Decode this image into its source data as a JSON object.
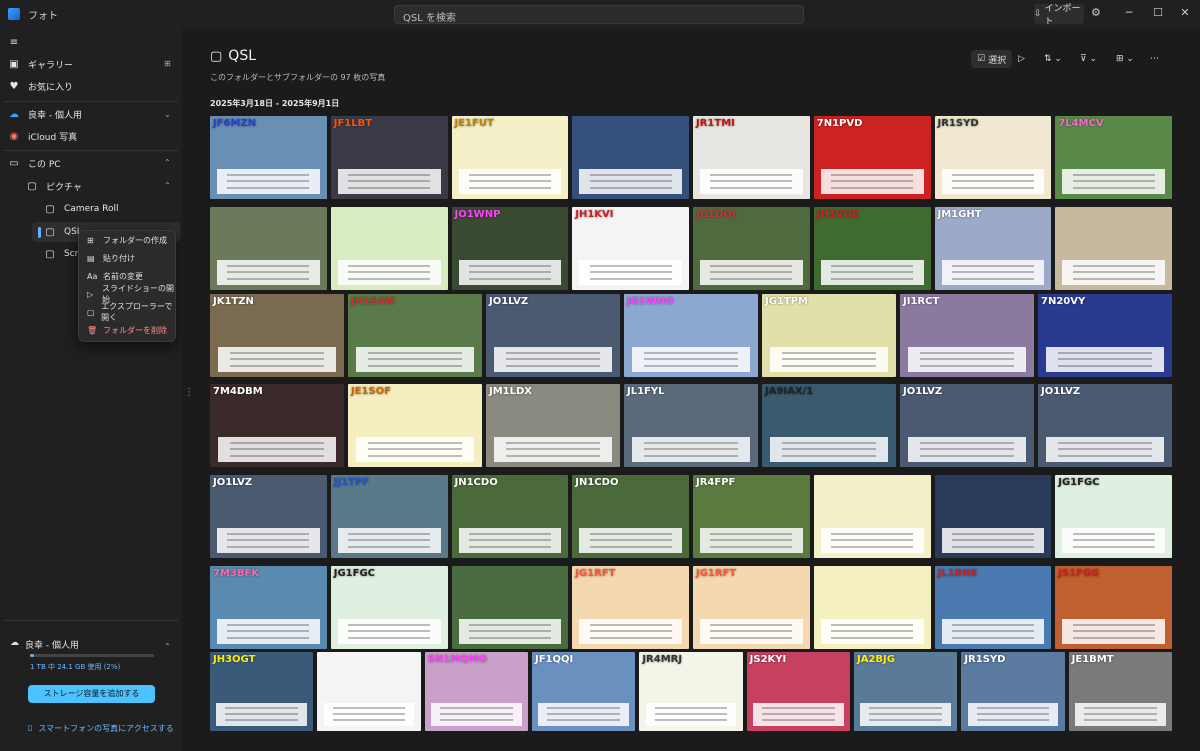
{
  "app": {
    "title": "フォト"
  },
  "search": {
    "placeholder": "QSL を検索"
  },
  "header": {
    "import_label": "インポート"
  },
  "sidebar": {
    "gallery": "ギャラリー",
    "favorites": "お気に入り",
    "onedrive_personal": "良幸 - 個人用",
    "icloud": "iCloud 写真",
    "this_pc": "この PC",
    "pictures": "ピクチャ",
    "camera_roll": "Camera Roll",
    "qsl": "QSL",
    "screenshots": "Scre"
  },
  "context_menu": [
    {
      "label": "フォルダーの作成",
      "icon": "folder-plus-icon"
    },
    {
      "label": "貼り付け",
      "icon": "paste-icon"
    },
    {
      "label": "名前の変更",
      "icon": "rename-icon"
    },
    {
      "label": "スライドショーの開始",
      "icon": "slideshow-icon"
    },
    {
      "label": "エクスプローラーで開く",
      "icon": "explorer-icon"
    },
    {
      "label": "フォルダーを削除",
      "icon": "trash-icon"
    }
  ],
  "storage": {
    "account": "良幸 - 個人用",
    "usage_text": "1 TB 中 24.1 GB 使用 (2%)",
    "used_fraction": 0.02,
    "add_button": "ストレージ容量を追加する"
  },
  "phone_link": "スマートフォンの写真にアクセスする",
  "folder": {
    "name": "QSL",
    "subtitle": "このフォルダーとサブフォルダーの 97 枚の写真",
    "date_range": "2025年3月18日 - 2025年9月1日",
    "select_label": "選択"
  },
  "colors": {
    "accent": "#4cc2ff"
  },
  "photos": [
    {
      "row": 0,
      "label": "JF6MZN",
      "bg": "#6a8fb5",
      "fg": "#2244cc"
    },
    {
      "row": 0,
      "label": "JF1LBT",
      "bg": "#3a3a48",
      "fg": "#ff5500"
    },
    {
      "row": 0,
      "label": "JE1FUT",
      "bg": "#f4f0c8",
      "fg": "#c08000"
    },
    {
      "row": 0,
      "label": "",
      "bg": "#34507a",
      "fg": "#fff"
    },
    {
      "row": 0,
      "label": "JR1TMI",
      "bg": "#e8e6e0",
      "fg": "#cc1111"
    },
    {
      "row": 0,
      "label": "7N1PVD",
      "bg": "#cc2222",
      "fg": "#ffffff"
    },
    {
      "row": 0,
      "label": "JR1SYD",
      "bg": "#f0e8d0",
      "fg": "#333"
    },
    {
      "row": 0,
      "label": "7L4MCV",
      "bg": "#5a8a4a",
      "fg": "#ff66cc"
    },
    {
      "row": 1,
      "label": "",
      "bg": "#6a7a5a",
      "fg": "#fff"
    },
    {
      "row": 1,
      "label": "",
      "bg": "#d8ecc0",
      "fg": "#333"
    },
    {
      "row": 1,
      "label": "JO1WNP",
      "bg": "#3a4a30",
      "fg": "#ff44ff"
    },
    {
      "row": 1,
      "label": "JH1KVI",
      "bg": "#f4f4f4",
      "fg": "#cc2222"
    },
    {
      "row": 1,
      "label": "JG1OQI",
      "bg": "#506a40",
      "fg": "#cc3333"
    },
    {
      "row": 1,
      "label": "JH1VUZ",
      "bg": "#3f6a30",
      "fg": "#cc2222"
    },
    {
      "row": 1,
      "label": "JM1GHT",
      "bg": "#9aaac8",
      "fg": "#ffffff"
    },
    {
      "row": 1,
      "label": "",
      "bg": "#c8b8a0",
      "fg": "#333"
    },
    {
      "row": 2,
      "label": "JK1TZN",
      "bg": "#7a6a50",
      "fg": "#ffffff"
    },
    {
      "row": 2,
      "label": "JH1EAW",
      "bg": "#5a7a4a",
      "fg": "#cc3333"
    },
    {
      "row": 2,
      "label": "JO1LVZ",
      "bg": "#4a5a70",
      "fg": "#ffffff"
    },
    {
      "row": 2,
      "label": "JG1WNO",
      "bg": "#8aa8d0",
      "fg": "#ff44ff"
    },
    {
      "row": 2,
      "label": "JG1TPM",
      "bg": "#e0e0a8",
      "fg": "#ffffff"
    },
    {
      "row": 2,
      "label": "JI1RCT",
      "bg": "#8a7aa0",
      "fg": "#ffffff"
    },
    {
      "row": 2,
      "label": "7N20VY",
      "bg": "#2a3a90",
      "fg": "#ffffff"
    },
    {
      "row": 3,
      "label": "7M4DBM",
      "bg": "#3a2a2a",
      "fg": "#ffffff"
    },
    {
      "row": 3,
      "label": "JE1SOF",
      "bg": "#f4eec0",
      "fg": "#cc6600"
    },
    {
      "row": 3,
      "label": "JM1LDX",
      "bg": "#8a8a80",
      "fg": "#ffffff"
    },
    {
      "row": 3,
      "label": "JL1FYL",
      "bg": "#5a6a7a",
      "fg": "#ffffff"
    },
    {
      "row": 3,
      "label": "JA9IAX/1",
      "bg": "#3a5a70",
      "fg": "#222"
    },
    {
      "row": 3,
      "label": "JO1LVZ",
      "bg": "#4a5a70",
      "fg": "#ffffff"
    },
    {
      "row": 3,
      "label": "JO1LVZ",
      "bg": "#4a5a70",
      "fg": "#ffffff"
    },
    {
      "row": 4,
      "label": "JO1LVZ",
      "bg": "#4a5a70",
      "fg": "#ffffff"
    },
    {
      "row": 4,
      "label": "JJ1TPF",
      "bg": "#5a7a8a",
      "fg": "#2255cc"
    },
    {
      "row": 4,
      "label": "JN1CDO",
      "bg": "#4a6a3a",
      "fg": "#ffffff"
    },
    {
      "row": 4,
      "label": "JN1CDO",
      "bg": "#4a6a3a",
      "fg": "#ffffff"
    },
    {
      "row": 4,
      "label": "JR4FPF",
      "bg": "#5a7a40",
      "fg": "#ffffff"
    },
    {
      "row": 4,
      "label": "",
      "bg": "#f4f0c8",
      "fg": "#333"
    },
    {
      "row": 4,
      "label": "",
      "bg": "#2a3a5a",
      "fg": "#ff66aa"
    },
    {
      "row": 4,
      "label": "JG1FGC",
      "bg": "#e0f0e0",
      "fg": "#222"
    },
    {
      "row": 5,
      "label": "7M3BFK",
      "bg": "#5a8ab0",
      "fg": "#ff66aa"
    },
    {
      "row": 5,
      "label": "JG1FGC",
      "bg": "#e0f0e0",
      "fg": "#222"
    },
    {
      "row": 5,
      "label": "",
      "bg": "#4a6a40",
      "fg": "#fff"
    },
    {
      "row": 5,
      "label": "JG1RFT",
      "bg": "#f4d8b0",
      "fg": "#ff5533"
    },
    {
      "row": 5,
      "label": "JG1RFT",
      "bg": "#f4d8b0",
      "fg": "#ff5533"
    },
    {
      "row": 5,
      "label": "",
      "bg": "#f4f0c0",
      "fg": "#333"
    },
    {
      "row": 5,
      "label": "JL1BNE",
      "bg": "#4a7ab0",
      "fg": "#cc2222"
    },
    {
      "row": 5,
      "label": "JS1FGG",
      "bg": "#c06030",
      "fg": "#cc2222"
    },
    {
      "row": 6,
      "label": "JH3OGT",
      "bg": "#3a5a7a",
      "fg": "#ffee00"
    },
    {
      "row": 6,
      "label": "",
      "bg": "#f4f4f4",
      "fg": "#333"
    },
    {
      "row": 6,
      "label": "SN1MQMO",
      "bg": "#c8a0c8",
      "fg": "#ff44ff"
    },
    {
      "row": 6,
      "label": "JF1QQI",
      "bg": "#6a90c0",
      "fg": "#ffffff"
    },
    {
      "row": 6,
      "label": "JR4MRJ",
      "bg": "#f4f4e8",
      "fg": "#333"
    },
    {
      "row": 6,
      "label": "JS2KYI",
      "bg": "#c84060",
      "fg": "#ffffff"
    },
    {
      "row": 6,
      "label": "JA2BJG",
      "bg": "#5a7a9a",
      "fg": "#ffee00"
    },
    {
      "row": 6,
      "label": "JR1SYD",
      "bg": "#5a7aa0",
      "fg": "#ffffff"
    },
    {
      "row": 6,
      "label": "JE1BMT",
      "bg": "#7a7a7a",
      "fg": "#ffffff"
    }
  ]
}
